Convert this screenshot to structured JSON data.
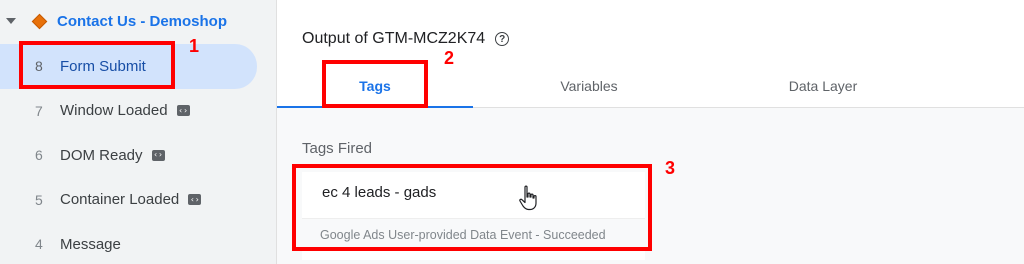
{
  "sidebar": {
    "summary_title": "Contact Us - Demoshop",
    "events": [
      {
        "num": "8",
        "label": "Form Submit",
        "badge": false,
        "selected": true
      },
      {
        "num": "7",
        "label": "Window Loaded",
        "badge": true,
        "selected": false
      },
      {
        "num": "6",
        "label": "DOM Ready",
        "badge": true,
        "selected": false
      },
      {
        "num": "5",
        "label": "Container Loaded",
        "badge": true,
        "selected": false
      },
      {
        "num": "4",
        "label": "Message",
        "badge": false,
        "selected": false
      }
    ]
  },
  "main": {
    "output_title": "Output of GTM-MCZ2K74",
    "tabs": [
      {
        "label": "Tags",
        "active": true
      },
      {
        "label": "Variables",
        "active": false
      },
      {
        "label": "Data Layer",
        "active": false
      }
    ],
    "section_title": "Tags Fired",
    "tag_card": {
      "name": "ec 4 leads - gads",
      "status": "Google Ads User-provided Data Event - Succeeded"
    }
  },
  "annotations": [
    "1",
    "2",
    "3"
  ],
  "colors": {
    "accent": "#1a73e8",
    "annotation": "#ff0000",
    "selected_bg": "#d2e3fc",
    "diamond": "#e8710a"
  },
  "icons": [
    "caret-down-icon",
    "diamond-icon",
    "help-icon",
    "code-badge-icon",
    "hand-pointer-icon"
  ]
}
